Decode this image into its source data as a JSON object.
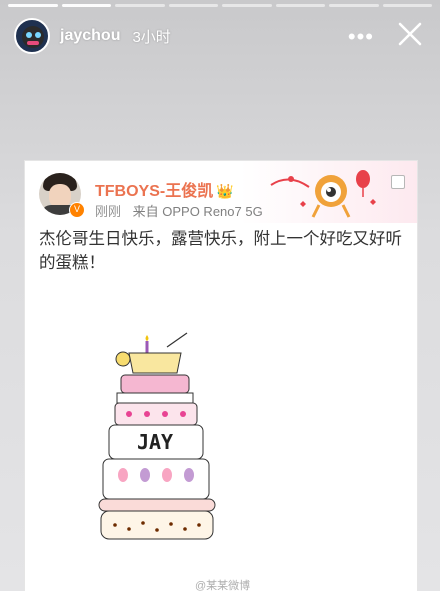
{
  "story": {
    "username": "jaychou",
    "time": "3小时",
    "more_label": "•••",
    "icons": {
      "avatar": "avatar-icon",
      "more": "more-icon",
      "close": "close-icon"
    }
  },
  "post": {
    "author": "TFBOYS-王俊凯",
    "crown": "👑",
    "timestamp": "刚刚",
    "source": "来自 OPPO Reno7 5G",
    "text": "杰伦哥生日快乐，露营快乐，附上一个好吃又好听的蛋糕！",
    "cake_text": "JAY",
    "watermark": "@某某微博"
  },
  "colors": {
    "author": "#eb7350",
    "text": "#333333",
    "verified": "#ff8200"
  }
}
